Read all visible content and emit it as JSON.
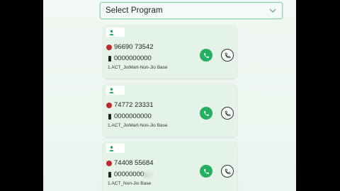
{
  "select": {
    "label": "Select Program"
  },
  "cards": [
    {
      "number": "96690 73542",
      "mobile": "0000000000",
      "program": "1.ACT_JioMart-Non-Jio Base"
    },
    {
      "number": "74772 23331",
      "mobile": "0000000000",
      "program": "1.ACT_JioMart-Non-Jio Base"
    },
    {
      "number": "74408 55684",
      "mobile": "00000000",
      "program": "1.ACT_Non-Jio Base"
    }
  ],
  "icons": {
    "avatar": "person-icon",
    "jio": "jio-logo-icon",
    "mobile": "mobile-phone-icon",
    "call": "phone-icon",
    "dropdown": "chevron-down-icon"
  },
  "colors": {
    "accent": "#25b061",
    "card": "#e4f3e8",
    "jio": "#c0272d"
  }
}
